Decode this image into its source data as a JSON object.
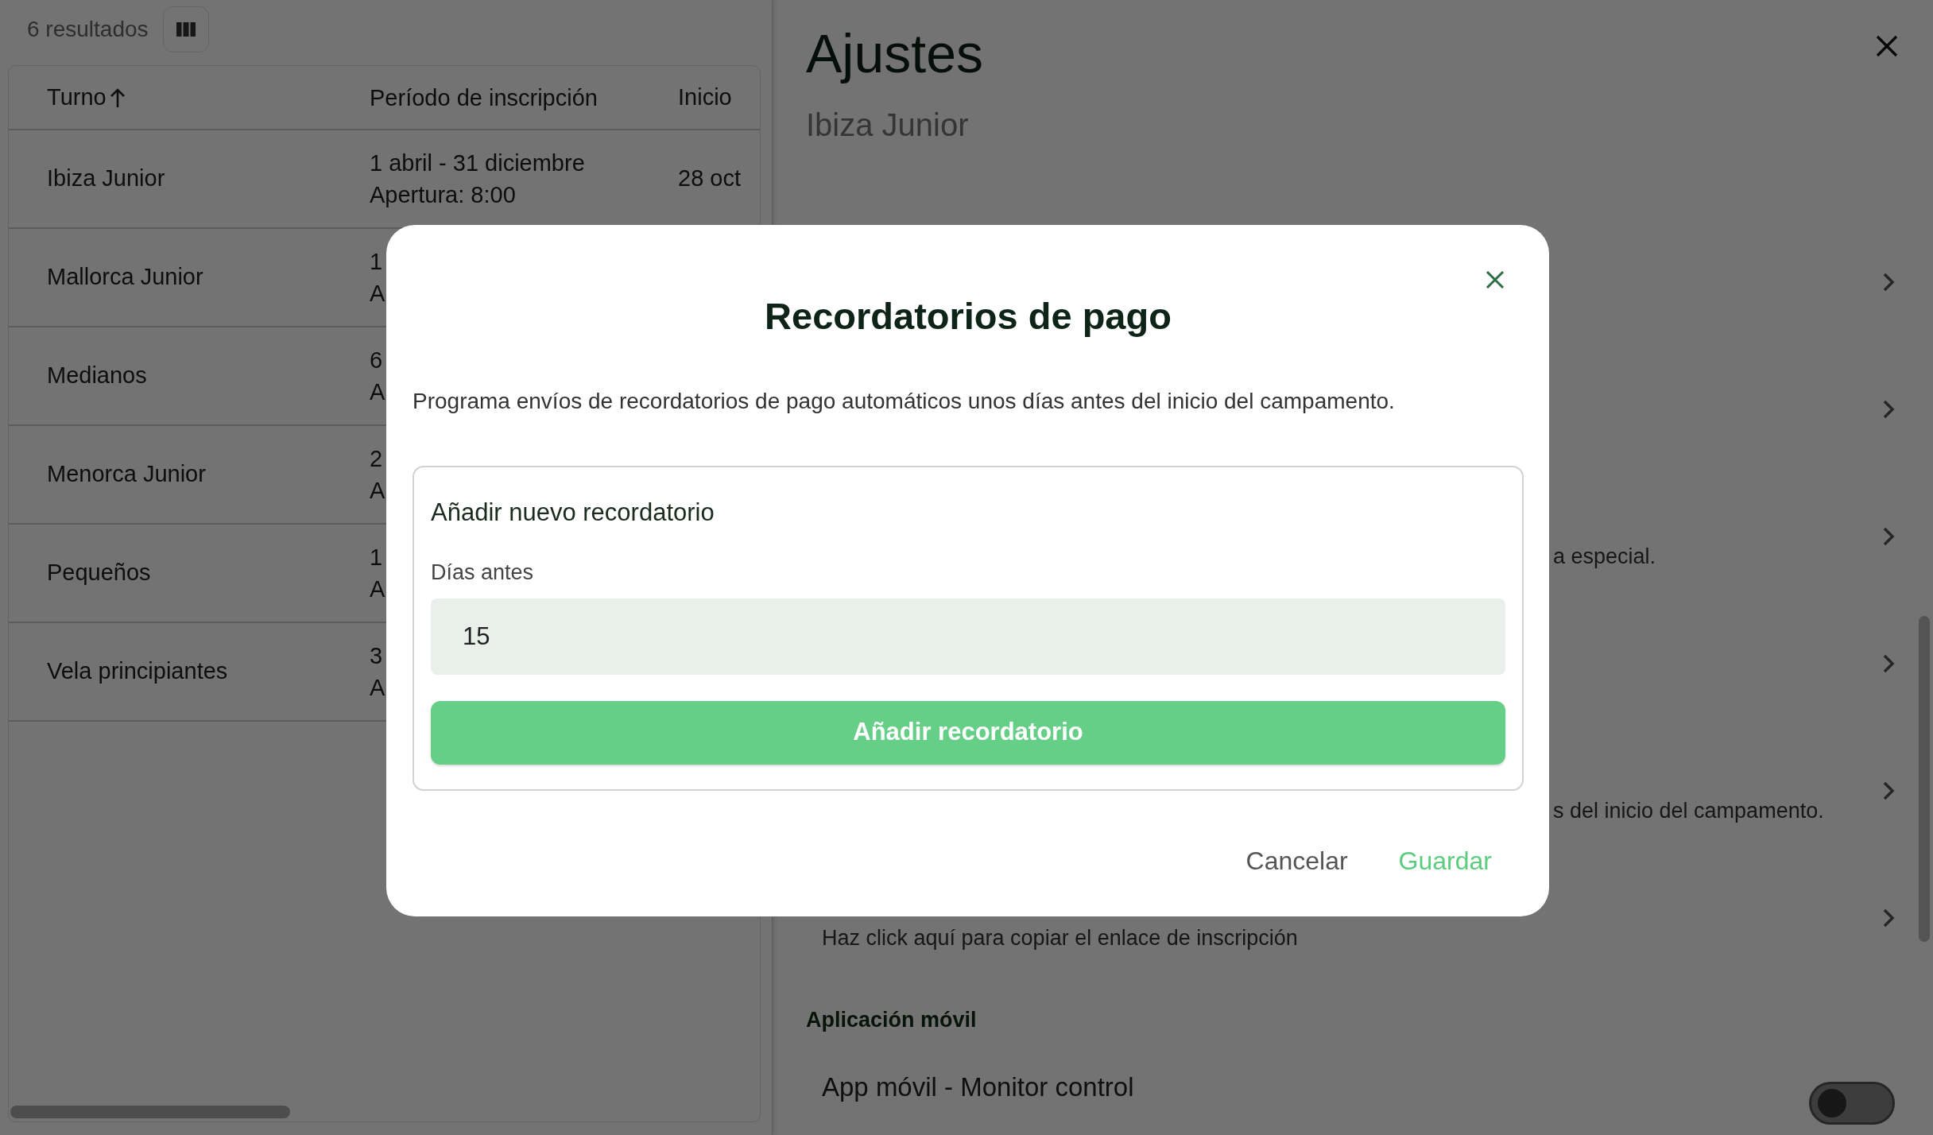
{
  "results": {
    "count": "6 resultados"
  },
  "table": {
    "columns": [
      {
        "label": "Turno",
        "sorted": true
      },
      {
        "label": "Período de inscripción",
        "sorted": false
      },
      {
        "label": "Inicio",
        "sorted": false
      }
    ],
    "rows": [
      {
        "turno": "Ibiza Junior",
        "periodo": [
          "1 abril - 31 diciembre",
          "Apertura: 8:00"
        ],
        "inicio": "28 oct"
      },
      {
        "turno": "Mallorca Junior",
        "periodo": [
          "1",
          "A"
        ]
      },
      {
        "turno": "Medianos",
        "periodo": [
          "6",
          "A"
        ]
      },
      {
        "turno": "Menorca Junior",
        "periodo": [
          "2",
          "A"
        ]
      },
      {
        "turno": "Pequeños",
        "periodo": [
          "1",
          "A"
        ]
      },
      {
        "turno": "Vela principiantes",
        "periodo": [
          "3",
          "A"
        ]
      }
    ]
  },
  "settings": {
    "title": "Ajustes",
    "subtitle": "Ibiza Junior",
    "rows": [
      {},
      {},
      {
        "description": "a especial."
      },
      {},
      {
        "description": "s del inicio del campamento."
      },
      {
        "description": "Haz click aquí para copiar el enlace de inscripción"
      }
    ],
    "section": "Aplicación móvil",
    "toggle_row": {
      "label": "App móvil - Monitor control",
      "on": false
    }
  },
  "modal": {
    "title": "Recordatorios de pago",
    "description": "Programa envíos de recordatorios de pago automáticos unos días antes del inicio del campamento.",
    "card": {
      "title": "Añadir nuevo recordatorio",
      "field": {
        "label": "Días antes",
        "value": "15"
      },
      "button": "Añadir recordatorio"
    },
    "buttons": [
      {
        "label": "Cancelar",
        "kind": "secondary"
      },
      {
        "label": "Guardar",
        "kind": "primary"
      }
    ]
  }
}
